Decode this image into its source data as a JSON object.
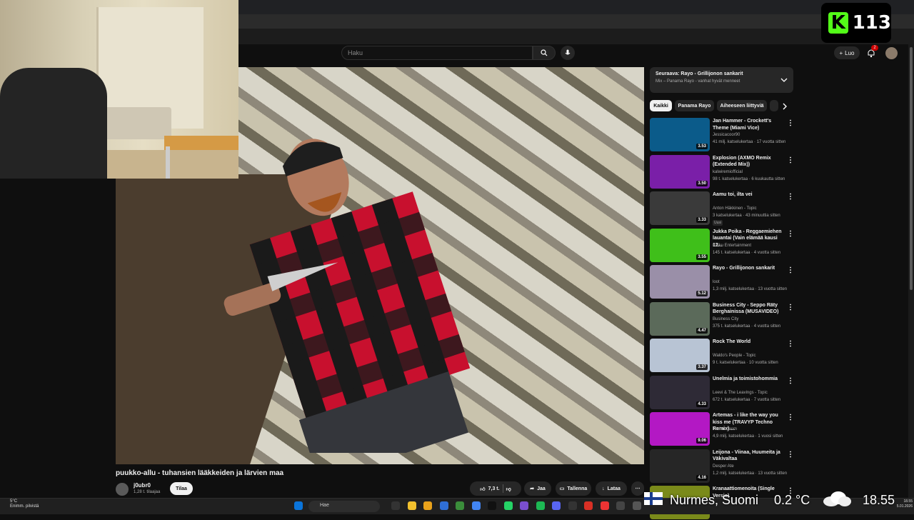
{
  "overlay": {
    "kick_count": "113",
    "kick_logo_letter": "K"
  },
  "header": {
    "search_placeholder": "Haku",
    "create_label": "Luo",
    "notifications_count": "2"
  },
  "video": {
    "title": "puukko-allu - tuhansien lääkkeiden ja lärvien maa",
    "channel_name": "j0ubr0",
    "channel_subs": "1,28 t. tilaajaa",
    "subscribe_label": "Tilaa",
    "likes": "7,3 t.",
    "share_label": "Jaa",
    "save_label": "Tallenna",
    "download_label": "Lataa"
  },
  "sidebar": {
    "next_title": "Seuraava: Rayo - Grillijonon sankarit",
    "next_sub": "Mix – Panama Rayo - vanhat hyvät menneet",
    "chips": [
      "Kaikki",
      "Panama Rayo",
      "Aiheeseen liittyviä",
      ""
    ],
    "recommendations": [
      {
        "title": "Jan Hammer - Crockett's Theme (Miami Vice)",
        "channel": "Jessicacoor90",
        "meta": "41 milj. katselukertaa · 17 vuotta sitten",
        "duration": "3.53",
        "color": "#0b5b8a",
        "new": ""
      },
      {
        "title": "Explosion (AXMO Remix (Extended Mix))",
        "channel": "kalwiremiofficial",
        "meta": "98 t. katselukertaa · 6 kuukautta sitten",
        "duration": "3.50",
        "color": "#7a1fa8",
        "new": ""
      },
      {
        "title": "Aamu toi, ilta vei",
        "channel": "Anton Häkkinen - Topic",
        "meta": "3 katselukertaa · 43 minuuttia sitten",
        "duration": "3.33",
        "color": "#3a3a3a",
        "new": "Uusi"
      },
      {
        "title": "Jukka Poika - Reggaemiehen lauantai (Vain elämää kausi 12...",
        "channel": "Kaiku Entertainment",
        "meta": "145 t. katselukertaa · 4 vuotta sitten",
        "duration": "3.55",
        "color": "#3fbf1a",
        "new": ""
      },
      {
        "title": "Rayo - Grillijonon sankarit",
        "channel": "loot",
        "meta": "1,3 milj. katselukertaa · 13 vuotta sitten",
        "duration": "5.12",
        "color": "#9a8fa8",
        "new": ""
      },
      {
        "title": "Business City - Seppo Räty Berghainissa (MUSAVIDEO)",
        "channel": "Business City",
        "meta": "375 t. katselukertaa · 4 vuotta sitten",
        "duration": "4.47",
        "color": "#5b6a5a",
        "new": ""
      },
      {
        "title": "Rock The World",
        "channel": "Waldo's People - Topic",
        "meta": "9 t. katselukertaa · 10 vuotta sitten",
        "duration": "3.37",
        "color": "#b8c4d4",
        "new": ""
      },
      {
        "title": "Unelmia ja toimistohommia",
        "channel": "Leevi & The Leavings - Topic",
        "meta": "672 t. katselukertaa · 7 vuotta sitten",
        "duration": "4.33",
        "color": "#2e2a36",
        "new": ""
      },
      {
        "title": "Artemas - i like the way you kiss me (TRAVYP Techno Remix) ...",
        "channel": "Technogasm",
        "meta": "4,9 milj. katselukertaa · 1 vuosi sitten",
        "duration": "9.06",
        "color": "#b318c4",
        "new": ""
      },
      {
        "title": "Leijona - Viinaa, Huumeita ja Väkivaltaa",
        "channel": "Desper Ate",
        "meta": "1,2 milj. katselukertaa · 13 vuotta sitten",
        "duration": "4.16",
        "color": "#262626",
        "new": ""
      },
      {
        "title": "Kranaattiomenoita (Single Versio)",
        "channel": "",
        "meta": "",
        "duration": "",
        "color": "#7a8a1a",
        "new": ""
      }
    ]
  },
  "taskbar": {
    "weather_temp": "5°C",
    "weather_desc": "Enimm. pilvistä",
    "search_label": "Hae",
    "time": "18.55",
    "date": "5.01.2026"
  },
  "weather_overlay": {
    "location": "Nurmes, Suomi",
    "temp": "0.2 °C",
    "time": "18.55"
  }
}
